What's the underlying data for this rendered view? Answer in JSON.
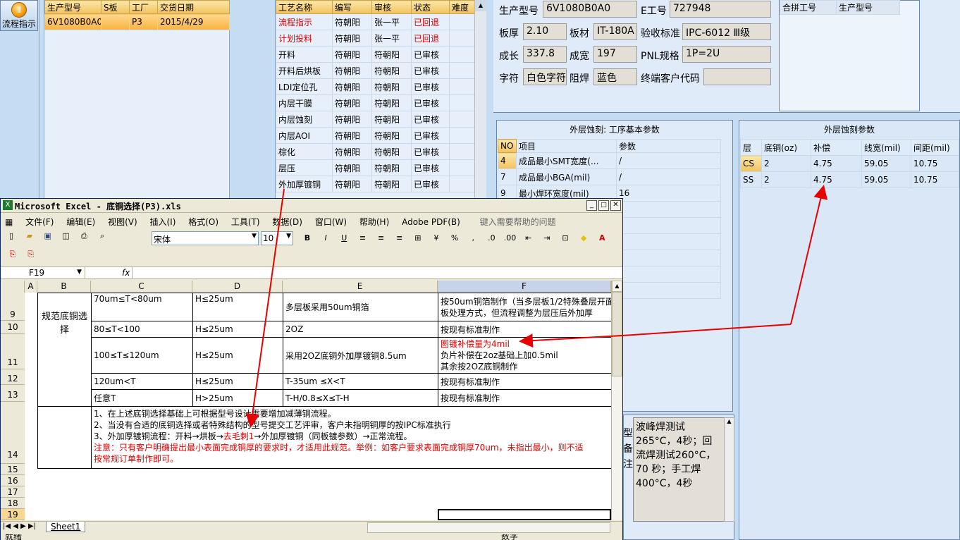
{
  "sidebar": {
    "flow_button": "流程指示"
  },
  "orders": {
    "headers": [
      "生产型号",
      "S板",
      "工厂",
      "交货日期"
    ],
    "rows": [
      [
        "6V1080B0A0",
        "",
        "P3",
        "2015/4/29"
      ]
    ]
  },
  "process": {
    "headers": [
      "工艺名称",
      "编写",
      "审核",
      "状态",
      "难度"
    ],
    "rows": [
      [
        "流程指示",
        "符朝阳",
        "张一平",
        "已回退",
        ""
      ],
      [
        "计划投料",
        "符朝阳",
        "张一平",
        "已回退",
        ""
      ],
      [
        "开料",
        "符朝阳",
        "符朝阳",
        "已审核",
        ""
      ],
      [
        "开料后烘板",
        "符朝阳",
        "符朝阳",
        "已审核",
        ""
      ],
      [
        "LDI定位孔",
        "符朝阳",
        "符朝阳",
        "已审核",
        ""
      ],
      [
        "内层干膜",
        "符朝阳",
        "符朝阳",
        "已审核",
        ""
      ],
      [
        "内层蚀刻",
        "符朝阳",
        "符朝阳",
        "已审核",
        ""
      ],
      [
        "内层AOI",
        "符朝阳",
        "符朝阳",
        "已审核",
        ""
      ],
      [
        "棕化",
        "符朝阳",
        "符朝阳",
        "已审核",
        ""
      ],
      [
        "层压",
        "符朝阳",
        "符朝阳",
        "已审核",
        ""
      ],
      [
        "外加厚镀铜",
        "符朝阳",
        "符朝阳",
        "已审核",
        ""
      ]
    ]
  },
  "info": {
    "prod_model_label": "生产型号",
    "prod_model": "6V1080B0A0",
    "e_no_label": "E工号",
    "e_no": "727948",
    "thickness_label": "板厚",
    "thickness": "2.10",
    "material_label": "板材",
    "material": "IT-180A",
    "std_label": "验收标准",
    "std": "IPC-6012 Ⅲ级",
    "length_label": "成长",
    "length": "337.8",
    "width_label": "成宽",
    "width": "197",
    "pnl_label": "PNL规格",
    "pnl": "1P=2U",
    "char_label": "字符",
    "char": "白色字符",
    "mask_label": "阻焊",
    "mask": "蓝色",
    "end_customer_label": "终端客户代码",
    "end_customer": ""
  },
  "merge": {
    "headers": [
      "合拼工号",
      "生产型号"
    ]
  },
  "basic_params": {
    "title": "外层蚀刻: 工序基本参数",
    "headers": [
      "NO",
      "项目",
      "参数"
    ],
    "rows": [
      [
        "4",
        "成品最小SMT宽度(...",
        "/"
      ],
      [
        "7",
        "成品最小BGA(mil)",
        "/"
      ],
      [
        "9",
        "最小焊环宽度(mil)",
        "16"
      ]
    ]
  },
  "etch_params": {
    "title": "外层蚀刻参数",
    "headers": [
      "层",
      "底铜(oz)",
      "补偿",
      "线宽(mil)",
      "间距(mil)"
    ],
    "rows": [
      [
        "CS",
        "2",
        "4.75",
        "59.05",
        "10.75"
      ],
      [
        "SS",
        "2",
        "4.75",
        "59.05",
        "10.75"
      ]
    ]
  },
  "note_box": {
    "text": "波峰焊测试265°C，4秒；回流焊测试260°C，70 秒；手工焊400°C，4秒"
  },
  "side_chars": [
    "型",
    "备",
    "注"
  ],
  "excel": {
    "title": "Microsoft Excel - 底铜选择(P3).xls",
    "menus": [
      "文件(F)",
      "编辑(E)",
      "视图(V)",
      "插入(I)",
      "格式(O)",
      "工具(T)",
      "数据(D)",
      "窗口(W)",
      "帮助(H)",
      "Adobe PDF(B)"
    ],
    "help_placeholder": "键入需要帮助的问题",
    "font_name": "宋体",
    "font_size": "10",
    "cell_ref": "F19",
    "fx": "fx",
    "columns": [
      "A",
      "B",
      "C",
      "D",
      "E",
      "F"
    ],
    "row_numbers": [
      "9",
      "10",
      "11",
      "12",
      "13",
      "14",
      "15",
      "16",
      "17",
      "18",
      "19"
    ],
    "merged_label": "规范底铜选择",
    "rows": [
      {
        "c": "70um≤T<80um",
        "d": "H≤25um",
        "e": "多层板采用50um铜箔",
        "f": "按50um铜箔制作（当多层板1/2特殊叠层开面板处理方式，但流程调整为层压后外加厚"
      },
      {
        "c": "80≤T<100",
        "d": "H≤25um",
        "e": "2OZ",
        "f": "按现有标准制作"
      },
      {
        "c": "100≤T≤120um",
        "d": "H≤25um",
        "e": "采用2OZ底铜外加厚镀铜8.5um",
        "f1": "图镀补偿量为4mil",
        "f2": "负片补偿在2oz基础上加0.5mil",
        "f3": "其余按2OZ底铜制作"
      },
      {
        "c": "120um<T",
        "d": "H≤25um",
        "e": "T-35um ≤X<T",
        "f": "按现有标准制作"
      },
      {
        "c": "任意T",
        "d": "H>25um",
        "e": "T-H/0.8≤X≤T-H",
        "f": "按现有标准制作"
      }
    ],
    "note1": "1、在上述底铜选择基础上可根据型号设计需要增加减薄铜流程。",
    "note2": "2、当没有合适的底铜选择或者特殊结构的型号提交工艺评审，客户未指明铜厚的按IPC标准执行",
    "note3a": "3、外加厚镀铜流程：开料→烘板→",
    "note3b": "去毛刺1",
    "note3c": "→外加厚镀铜（同板镀参数）→正常流程。",
    "note4": "注意：只有客户明确提出最小表面完成铜厚的要求时，才适用此规范。举例：如客户要求表面完成铜厚70um，未指出最小，则不适",
    "note5": "按常规订单制作即可。",
    "sheet_tab": "Sheet1",
    "status_left": "就绪",
    "status_right": "数字"
  }
}
